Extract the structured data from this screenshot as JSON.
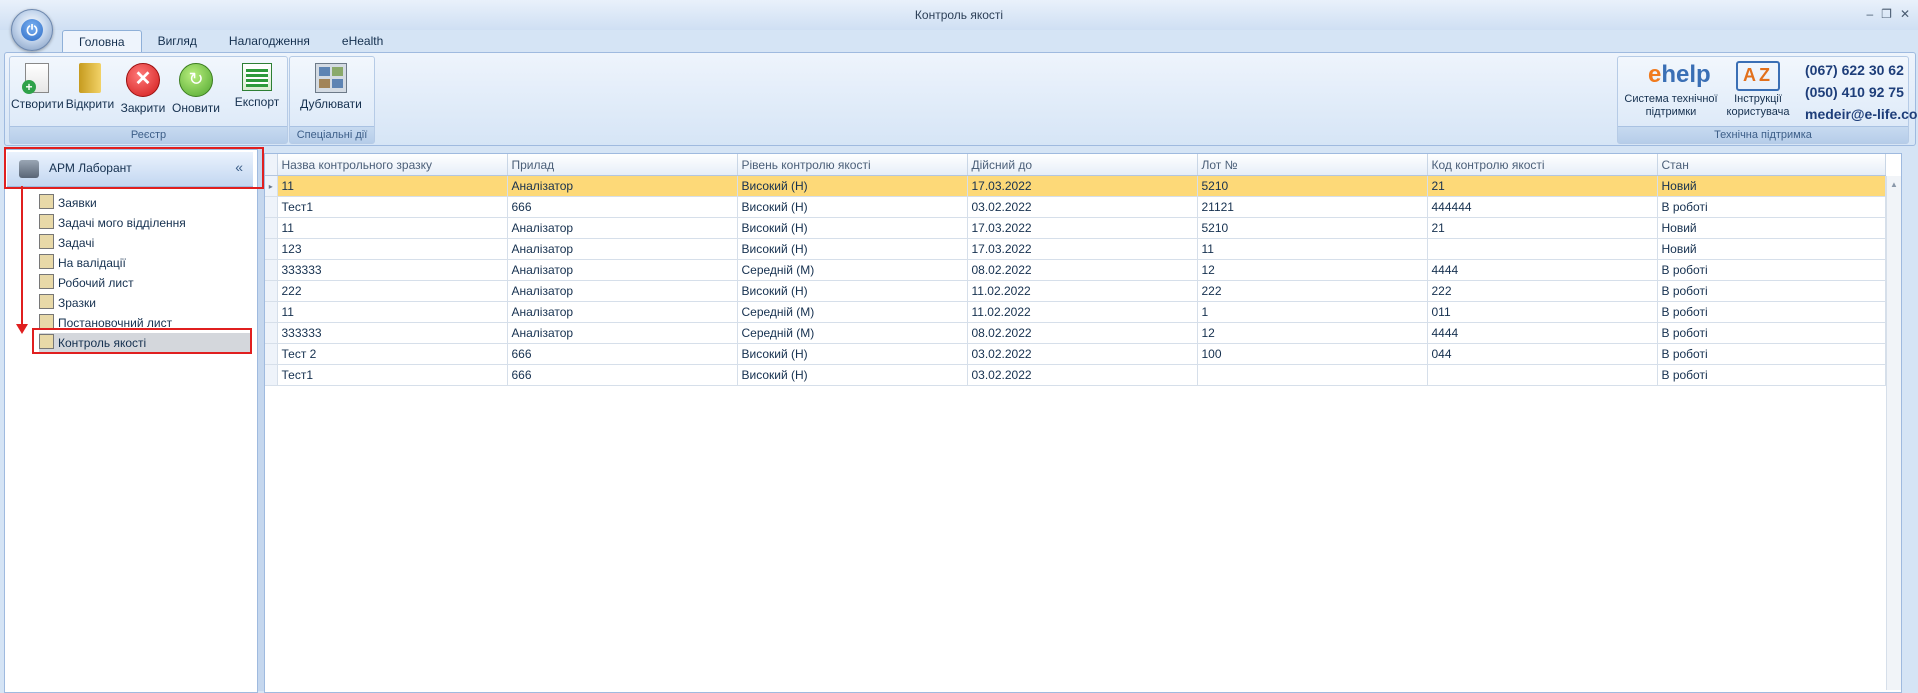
{
  "window": {
    "title": "Контроль якості",
    "controls": {
      "minimize": "–",
      "restore": "❐",
      "close": "✕"
    }
  },
  "tabs": [
    "Головна",
    "Вигляд",
    "Налагодження",
    "eHealth"
  ],
  "ribbon": {
    "registry": {
      "title": "Реєстр",
      "buttons": [
        "Створити",
        "Відкрити",
        "Закрити",
        "Оновити",
        "Експорт"
      ]
    },
    "special": {
      "title": "Спеціальні дії",
      "buttons": [
        "Дублювати"
      ]
    },
    "support": {
      "title": "Технічна підтримка",
      "logo_e": "e",
      "logo_help": "help",
      "az_letters": "AZ",
      "system_label_1": "Система технічної",
      "system_label_2": "підтримки",
      "instructions_label_1": "Інструкції",
      "instructions_label_2": "користувача",
      "phone1": "(067) 622 30 62",
      "phone2": "(050) 410 92 75",
      "email": "medeir@e-life.com.ua"
    }
  },
  "nav": {
    "header": "АРМ Лаборант",
    "collapse": "«",
    "items": [
      "Заявки",
      "Задачі мого відділення",
      "Задачі",
      "На валідації",
      "Робочий лист",
      "Зразки",
      "Постановочний лист",
      "Контроль якості"
    ]
  },
  "grid": {
    "columns": [
      "Назва контрольного зразку",
      "Прилад",
      "Рівень контролю якості",
      "Дійсний до",
      "Лот №",
      "Код контролю якості",
      "Стан"
    ],
    "rows": [
      [
        "11",
        "Аналізатор",
        "Високий (H)",
        "17.03.2022",
        "5210",
        "21",
        "Новий"
      ],
      [
        "Тест1",
        "666",
        "Високий (H)",
        "03.02.2022",
        "21121",
        "444444",
        "В роботі"
      ],
      [
        "11",
        "Аналізатор",
        "Високий (H)",
        "17.03.2022",
        "5210",
        "21",
        "Новий"
      ],
      [
        "123",
        "Аналізатор",
        "Високий (H)",
        "17.03.2022",
        "11",
        "",
        "Новий"
      ],
      [
        "333333",
        "Аналізатор",
        "Середній (M)",
        "08.02.2022",
        "12",
        "4444",
        "В роботі"
      ],
      [
        "222",
        "Аналізатор",
        "Високий (H)",
        "11.02.2022",
        "222",
        "222",
        "В роботі"
      ],
      [
        "11",
        "Аналізатор",
        "Середній (M)",
        "11.02.2022",
        "1",
        "011",
        "В роботі"
      ],
      [
        "333333",
        "Аналізатор",
        "Середній (M)",
        "08.02.2022",
        "12",
        "4444",
        "В роботі"
      ],
      [
        "Тест 2",
        "666",
        "Високий (H)",
        "03.02.2022",
        "100",
        "044",
        "В роботі"
      ],
      [
        "Тест1",
        "666",
        "Високий (H)",
        "03.02.2022",
        "",
        "",
        "В роботі"
      ]
    ],
    "selected_row": 0
  },
  "colors": {
    "selected_row": "#fdd978",
    "highlight": "#e01f1f",
    "accent": "#3a6fb5"
  }
}
